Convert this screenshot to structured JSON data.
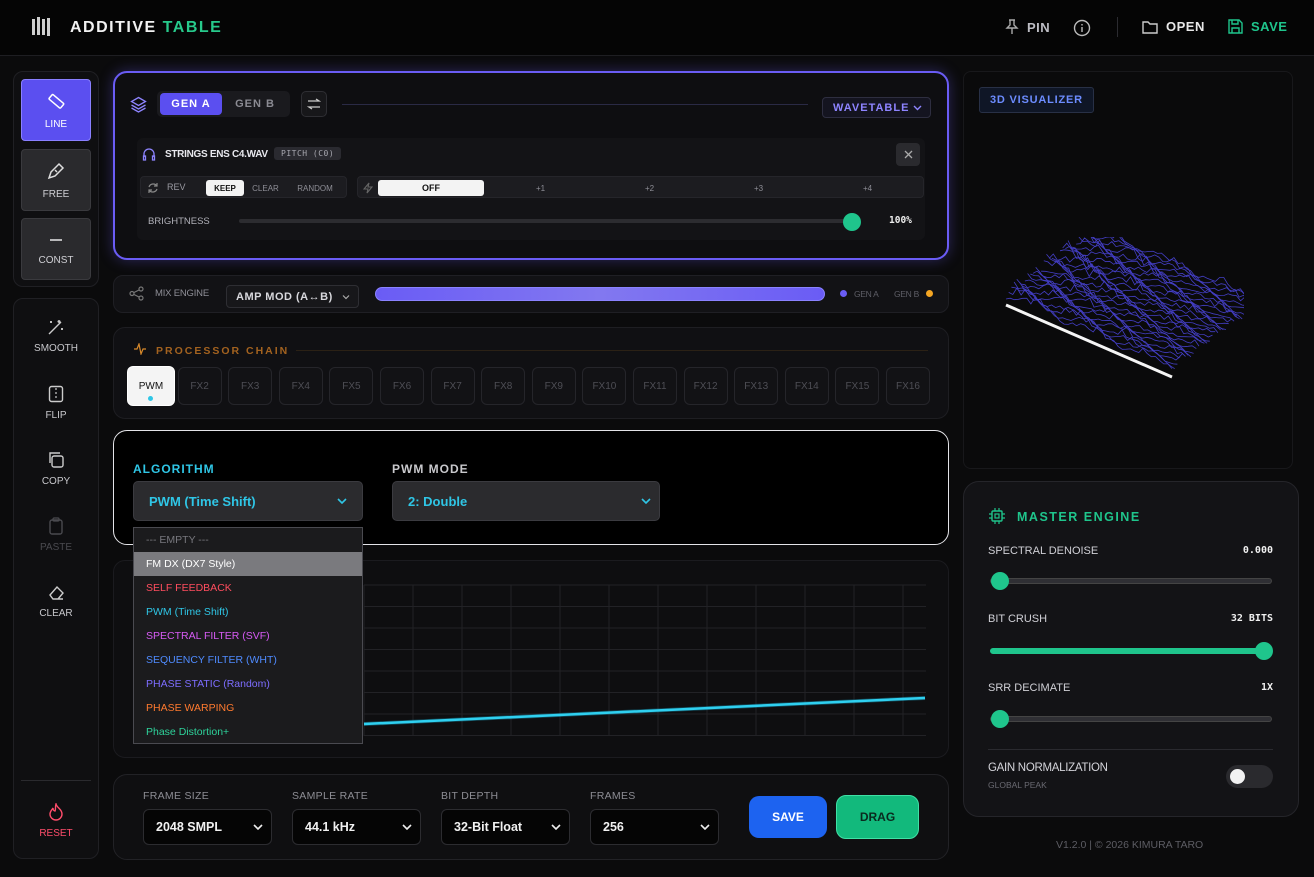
{
  "app": {
    "title_a": "ADDITIVE",
    "title_b": "TABLE"
  },
  "topbar": {
    "pin": "PIN",
    "open": "OPEN",
    "save": "SAVE"
  },
  "tools": [
    {
      "label": "LINE",
      "icon": "ruler-icon",
      "active": true
    },
    {
      "label": "FREE",
      "icon": "pen-icon",
      "active": false
    },
    {
      "label": "CONST",
      "icon": "minus-icon",
      "active": false
    }
  ],
  "actions": {
    "smooth": "SMOOTH",
    "flip": "FLIP",
    "copy": "COPY",
    "paste": "PASTE",
    "clear": "CLEAR",
    "reset": "RESET"
  },
  "generator": {
    "tab_a": "GEN A",
    "tab_b": "GEN B",
    "source_type": "WAVETABLE",
    "file_name": "STRINGS ENS C4.WAV",
    "pitch_badge": "PITCH (C0)",
    "rev_label": "REV",
    "rev_options": [
      "KEEP",
      "CLEAR",
      "RANDOM"
    ],
    "rev_selected": "KEEP",
    "octave_options": [
      "OFF",
      "+1",
      "+2",
      "+3",
      "+4"
    ],
    "octave_selected": "OFF",
    "brightness_label": "BRIGHTNESS",
    "brightness_value": "100%",
    "brightness_level": 1.0
  },
  "mix": {
    "label": "MIX ENGINE",
    "mode": "AMP MOD (A↔B)",
    "gen_a": "GEN A",
    "gen_b": "GEN B",
    "accent_a": "#6a5cf5",
    "accent_b": "#f5a623"
  },
  "processor": {
    "title": "PROCESSOR CHAIN",
    "slots": [
      "PWM",
      "FX2",
      "FX3",
      "FX4",
      "FX5",
      "FX6",
      "FX7",
      "FX8",
      "FX9",
      "FX10",
      "FX11",
      "FX12",
      "FX13",
      "FX14",
      "FX15",
      "FX16"
    ],
    "active_slot": "PWM"
  },
  "algorithm": {
    "label": "ALGORITHM",
    "value": "PWM (Time Shift)",
    "mode_label": "PWM MODE",
    "mode_value": "2: Double",
    "options": [
      {
        "label": "--- EMPTY ---",
        "color": "#77777d"
      },
      {
        "label": "FM DX (DX7 Style)",
        "color": "#ffffff"
      },
      {
        "label": "SELF FEEDBACK",
        "color": "#ff4d5e"
      },
      {
        "label": "PWM (Time Shift)",
        "color": "#2fc6e6"
      },
      {
        "label": "SPECTRAL FILTER (SVF)",
        "color": "#d75bf5"
      },
      {
        "label": "SEQUENCY FILTER (WHT)",
        "color": "#4f8bff"
      },
      {
        "label": "PHASE STATIC (Random)",
        "color": "#7d6dff"
      },
      {
        "label": "PHASE WARPING",
        "color": "#ff7a2f"
      },
      {
        "label": "Phase Distortion+",
        "color": "#2ed39b"
      }
    ],
    "highlighted": "FM DX (DX7 Style)"
  },
  "export": {
    "frame_size_label": "FRAME SIZE",
    "frame_size": "2048 SMPL",
    "sample_rate_label": "SAMPLE RATE",
    "sample_rate": "44.1 kHz",
    "bit_depth_label": "BIT DEPTH",
    "bit_depth": "32-Bit Float",
    "frames_label": "FRAMES",
    "frames": "256",
    "save": "SAVE",
    "drag": "DRAG"
  },
  "visualizer": {
    "label": "3D VISUALIZER"
  },
  "master": {
    "title": "MASTER ENGINE",
    "denoise_label": "SPECTRAL DENOISE",
    "denoise_value": "0.000",
    "denoise_level": 0.0,
    "bitcrush_label": "BIT CRUSH",
    "bitcrush_value": "32 BITS",
    "bitcrush_level": 1.0,
    "srr_label": "SRR DECIMATE",
    "srr_value": "1X",
    "srr_level": 0.0,
    "gain_label": "GAIN NORMALIZATION",
    "gain_sub": "GLOBAL PEAK",
    "gain_on": false
  },
  "footer": {
    "version": "V1.2.0 | © 2026 KIMURA TARO"
  },
  "colors": {
    "accent_purple": "#5b4ff0",
    "accent_green": "#1fc58c",
    "accent_cyan": "#2fc6e6",
    "accent_orange": "#d98a2b"
  }
}
